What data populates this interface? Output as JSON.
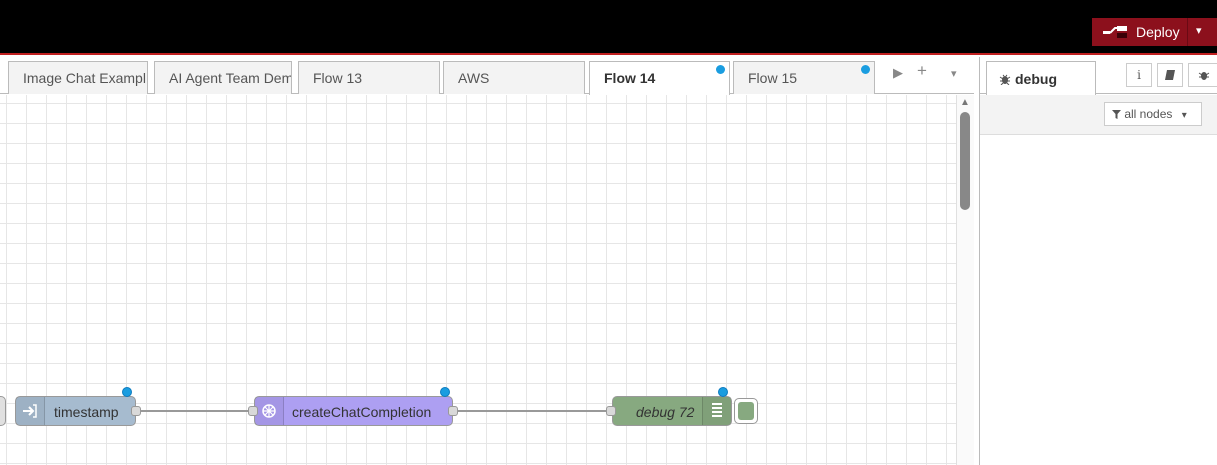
{
  "header": {
    "deploy_label": "Deploy",
    "deploy_caret": "▾"
  },
  "tabs": [
    {
      "label": "Image Chat Exampl",
      "active": false,
      "changed": false
    },
    {
      "label": "AI Agent Team Dem",
      "active": false,
      "changed": false
    },
    {
      "label": "Flow 13",
      "active": false,
      "changed": false
    },
    {
      "label": "AWS",
      "active": false,
      "changed": false
    },
    {
      "label": "Flow 14",
      "active": true,
      "changed": true
    },
    {
      "label": "Flow 15",
      "active": false,
      "changed": true
    }
  ],
  "tab_controls": {
    "scroll": "▶",
    "add": "+",
    "menu": "▾"
  },
  "nodes": [
    {
      "label": "timestamp",
      "type": "inject",
      "icon": "arrow-in-icon",
      "color": "#a6bbcf",
      "changed": true
    },
    {
      "label": "createChatCompletion",
      "type": "openai",
      "icon": "openai-icon",
      "color": "#ad9ff2",
      "changed": true
    },
    {
      "label": "debug 72",
      "type": "debug",
      "icon": "list-icon",
      "color": "#87a980",
      "changed": true
    }
  ],
  "sidebar": {
    "tab_label": "debug",
    "tab_icon": "bug-icon",
    "buttons": [
      "info-icon",
      "book-icon",
      "bug-icon"
    ],
    "info_glyph": "i",
    "filter_label": "all nodes",
    "filter_caret": "▾"
  },
  "colors": {
    "header": "#000000",
    "deploy": "#8c101c",
    "changed_dot": "#1a9de0"
  }
}
